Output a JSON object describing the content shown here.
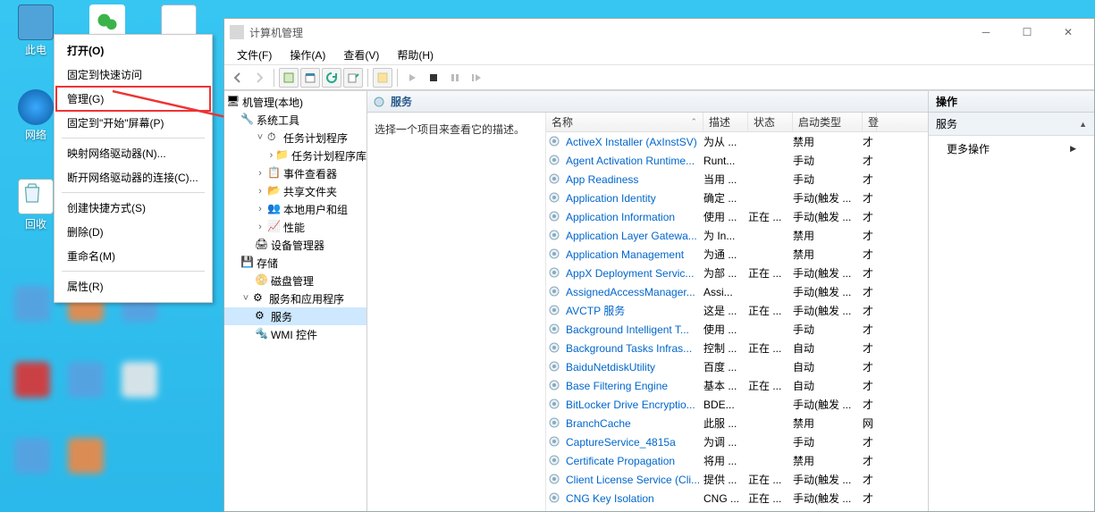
{
  "desktop": {
    "this_pc": "此电",
    "network": "网络",
    "recycle": "回收"
  },
  "context_menu": {
    "open": "打开(O)",
    "pin_quick": "固定到快速访问",
    "manage": "管理(G)",
    "pin_start": "固定到\"开始\"屏幕(P)",
    "map_drive": "映射网络驱动器(N)...",
    "disconnect": "断开网络驱动器的连接(C)...",
    "shortcut": "创建快捷方式(S)",
    "delete": "删除(D)",
    "rename": "重命名(M)",
    "properties": "属性(R)"
  },
  "window": {
    "title": "计算机管理",
    "menu": {
      "file": "文件(F)",
      "action": "操作(A)",
      "view": "查看(V)",
      "help": "帮助(H)"
    }
  },
  "tree": {
    "root": "机管理(本地)",
    "system_tools": "系统工具",
    "task_sched": "任务计划程序",
    "task_lib": "任务计划程序库",
    "event_viewer": "事件查看器",
    "shared": "共享文件夹",
    "local_users": "本地用户和组",
    "perf": "性能",
    "device_mgr": "设备管理器",
    "storage": "存储",
    "disk_mgmt": "磁盘管理",
    "services_apps": "服务和应用程序",
    "services": "服务",
    "wmi": "WMI 控件"
  },
  "mid": {
    "header": "服务",
    "prompt": "选择一个项目来查看它的描述。",
    "cols": {
      "name": "名称",
      "desc": "描述",
      "status": "状态",
      "startup": "启动类型",
      "extra": "登"
    }
  },
  "services": [
    {
      "name": "ActiveX Installer (AxInstSV)",
      "desc": "为从 ...",
      "status": "",
      "startup": "禁用",
      "x": "才"
    },
    {
      "name": "Agent Activation Runtime...",
      "desc": "Runt...",
      "status": "",
      "startup": "手动",
      "x": "才"
    },
    {
      "name": "App Readiness",
      "desc": "当用 ...",
      "status": "",
      "startup": "手动",
      "x": "才"
    },
    {
      "name": "Application Identity",
      "desc": "确定 ...",
      "status": "",
      "startup": "手动(触发 ...",
      "x": "才"
    },
    {
      "name": "Application Information",
      "desc": "使用 ...",
      "status": "正在 ...",
      "startup": "手动(触发 ...",
      "x": "才"
    },
    {
      "name": "Application Layer Gatewa...",
      "desc": "为 In...",
      "status": "",
      "startup": "禁用",
      "x": "才"
    },
    {
      "name": "Application Management",
      "desc": "为通 ...",
      "status": "",
      "startup": "禁用",
      "x": "才"
    },
    {
      "name": "AppX Deployment Servic...",
      "desc": "为部 ...",
      "status": "正在 ...",
      "startup": "手动(触发 ...",
      "x": "才"
    },
    {
      "name": "AssignedAccessManager...",
      "desc": "Assi...",
      "status": "",
      "startup": "手动(触发 ...",
      "x": "才"
    },
    {
      "name": "AVCTP 服务",
      "desc": "这是 ...",
      "status": "正在 ...",
      "startup": "手动(触发 ...",
      "x": "才"
    },
    {
      "name": "Background Intelligent T...",
      "desc": "使用 ...",
      "status": "",
      "startup": "手动",
      "x": "才"
    },
    {
      "name": "Background Tasks Infras...",
      "desc": "控制 ...",
      "status": "正在 ...",
      "startup": "自动",
      "x": "才"
    },
    {
      "name": "BaiduNetdiskUtility",
      "desc": "百度 ...",
      "status": "",
      "startup": "自动",
      "x": "才"
    },
    {
      "name": "Base Filtering Engine",
      "desc": "基本 ...",
      "status": "正在 ...",
      "startup": "自动",
      "x": "才"
    },
    {
      "name": "BitLocker Drive Encryptio...",
      "desc": "BDE...",
      "status": "",
      "startup": "手动(触发 ...",
      "x": "才"
    },
    {
      "name": "BranchCache",
      "desc": "此服 ...",
      "status": "",
      "startup": "禁用",
      "x": "网"
    },
    {
      "name": "CaptureService_4815a",
      "desc": "为调 ...",
      "status": "",
      "startup": "手动",
      "x": "才"
    },
    {
      "name": "Certificate Propagation",
      "desc": "将用 ...",
      "status": "",
      "startup": "禁用",
      "x": "才"
    },
    {
      "name": "Client License Service (Cli...",
      "desc": "提供 ...",
      "status": "正在 ...",
      "startup": "手动(触发 ...",
      "x": "才"
    },
    {
      "name": "CNG Key Isolation",
      "desc": "CNG ...",
      "status": "正在 ...",
      "startup": "手动(触发 ...",
      "x": "才"
    }
  ],
  "right": {
    "title": "操作",
    "section": "服务",
    "more": "更多操作"
  }
}
